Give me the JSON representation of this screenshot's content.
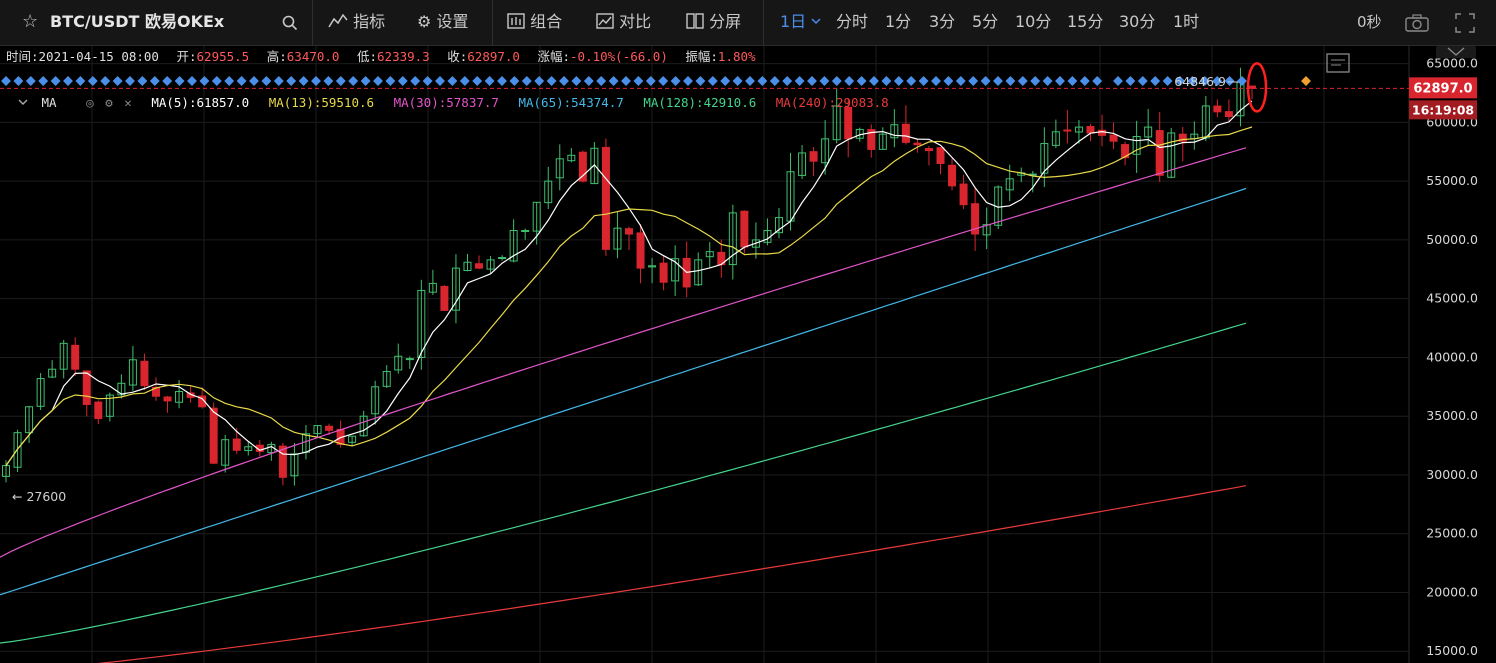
{
  "toolbar": {
    "symbol": "BTC/USDT 欧易OKEx",
    "indicators_label": "指标",
    "settings_label": "设置",
    "combo_label": "组合",
    "compare_label": "对比",
    "split_label": "分屏",
    "active_timeframe": "1日",
    "timeframes": [
      "分时",
      "1分",
      "3分",
      "5分",
      "10分",
      "15分",
      "30分",
      "1时"
    ],
    "countdown": "0秒"
  },
  "infobar": {
    "time_label": "时间:",
    "time_value": "2021-04-15 08:00",
    "open_label": "开:",
    "open_value": "62955.5",
    "high_label": "高:",
    "high_value": "63470.0",
    "low_label": "低:",
    "low_value": "62339.3",
    "close_label": "收:",
    "close_value": "62897.0",
    "change_label": "涨幅:",
    "change_value": "-0.10%(-66.0)",
    "amp_label": "振幅:",
    "amp_value": "1.80%"
  },
  "ma_bar": {
    "title": "MA",
    "items": [
      {
        "label": "MA(5):61857.0",
        "color": "#ffffff"
      },
      {
        "label": "MA(13):59510.6",
        "color": "#e8d94a"
      },
      {
        "label": "MA(30):57837.7",
        "color": "#e055c8"
      },
      {
        "label": "MA(65):54374.7",
        "color": "#44b8e8"
      },
      {
        "label": "MA(128):42910.6",
        "color": "#44d48c"
      },
      {
        "label": "MA(240):29083.8",
        "color": "#e83a3a"
      }
    ]
  },
  "colors": {
    "up": "#3fbf6e",
    "down": "#d9262e",
    "marker": "#4a8fe8",
    "marker_alt": "#f0a030",
    "highlight": "#ff2020",
    "accent": "#4a8fe8"
  },
  "chart_data": {
    "type": "candlestick",
    "ylim": [
      14000,
      66500
    ],
    "y_ticks": [
      "65000.0",
      "60000.0",
      "55000.0",
      "50000.0",
      "45000.0",
      "40000.0",
      "35000.0",
      "30000.0",
      "25000.0",
      "20000.0",
      "15000.0"
    ],
    "y_tick_values": [
      65000,
      60000,
      55000,
      50000,
      45000,
      40000,
      35000,
      30000,
      25000,
      20000,
      15000
    ],
    "last_price": "62897.0",
    "last_price_value": 62897.0,
    "countdown": "16:19:08",
    "max_label": "64846.9",
    "max_value": 64846.9,
    "min_label": "27600",
    "min_value": 27600,
    "closes": [
      30800,
      33600,
      35800,
      38200,
      39000,
      41200,
      39000,
      36000,
      34800,
      36800,
      37800,
      39800,
      37600,
      36700,
      36300,
      37100,
      36600,
      35800,
      31000,
      33000,
      32100,
      32400,
      32000,
      32600,
      29800,
      31800,
      33500,
      34200,
      33800,
      32600,
      33300,
      35000,
      37500,
      38800,
      40100,
      39900,
      45700,
      46300,
      44000,
      47600,
      48100,
      47600,
      48300,
      48500,
      50800,
      50800,
      53200,
      55000,
      56900,
      57200,
      55000,
      57800,
      49200,
      51000,
      50500,
      47600,
      47800,
      46400,
      48400,
      46000,
      48300,
      49000,
      47900,
      52300,
      49400,
      50000,
      50800,
      51900,
      55800,
      57400,
      56700,
      58600,
      61400,
      58600,
      59400,
      57700,
      59000,
      59800,
      58300,
      58100,
      57600,
      56500,
      54600,
      53000,
      50500,
      51300,
      54500,
      55200,
      55700,
      55600,
      58200,
      59200,
      59300,
      59600,
      59100,
      58900,
      58400,
      57000,
      58800,
      59600,
      55500,
      59100,
      58400,
      59000,
      61400,
      60900,
      60500,
      63400,
      62897
    ]
  }
}
